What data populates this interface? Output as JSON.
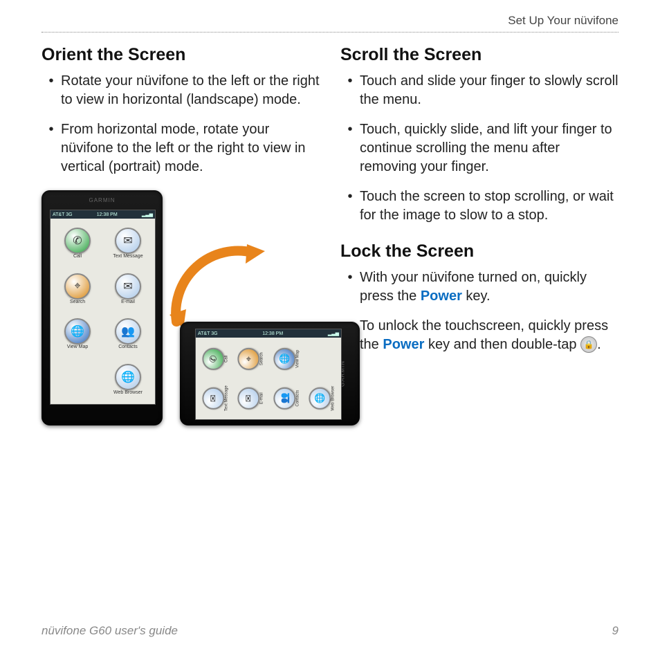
{
  "header": {
    "section": "Set Up Your nüvifone"
  },
  "left": {
    "heading": "Orient the Screen",
    "items": [
      "Rotate your nüvifone to the left or the right to view in horizontal (landscape) mode.",
      "From horizontal mode, rotate your nüvifone to the left or the right to view in vertical (portrait) mode."
    ]
  },
  "right": {
    "heading1": "Scroll the Screen",
    "items1": [
      "Touch and slide your finger to slowly scroll the menu.",
      "Touch, quickly slide, and lift your finger to continue scrolling the menu after removing your finger.",
      "Touch the screen to stop scrolling, or wait for the image to slow to a stop."
    ],
    "heading2": "Lock the Screen",
    "items2a_pre": "With your nüvifone turned on, quickly press the ",
    "items2a_kw": "Power",
    "items2a_post": " key.",
    "items2b_pre": "To unlock the touchscreen, quickly press the ",
    "items2b_kw": "Power",
    "items2b_post": " key and then double-tap ",
    "items2b_end": "."
  },
  "phone": {
    "brand": "GARMIN",
    "status_left": "AT&T 3G",
    "status_mid": "12:38 PM",
    "apps": [
      "Call",
      "Text Message",
      "Search",
      "E-mail",
      "View Map",
      "Contacts",
      "",
      "Web Browser"
    ],
    "colors": [
      "#25a03b",
      "#a9c7e8",
      "#d98814",
      "#a9c7e8",
      "#2e6bbd",
      "#a9c7e8",
      "transparent",
      "#a9c7e8"
    ],
    "glyph": [
      "✆",
      "✉",
      "⌖",
      "✉",
      "🌐",
      "👥",
      "",
      "🌐"
    ]
  },
  "footer": {
    "guide": "nüvifone G60 user's guide",
    "page": "9"
  }
}
